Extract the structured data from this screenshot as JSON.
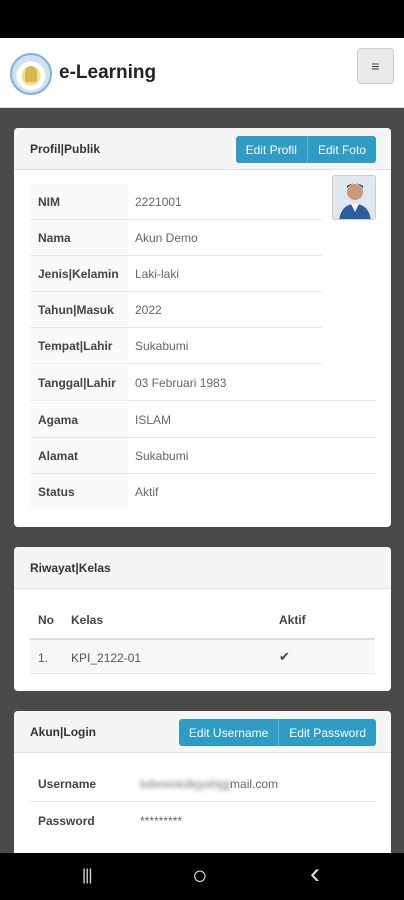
{
  "app": {
    "brand": "e-Learning",
    "menu_icon": "≡"
  },
  "profile": {
    "title": "Profil|Publik",
    "edit_profile": "Edit Profil",
    "edit_photo": "Edit Foto",
    "fields": [
      {
        "label": "NIM",
        "value": "2221001"
      },
      {
        "label": "Nama",
        "value": "Akun Demo"
      },
      {
        "label": "Jenis|Kelamin",
        "value": "Laki-laki"
      },
      {
        "label": "Tahun|Masuk",
        "value": "2022"
      },
      {
        "label": "Tempat|Lahir",
        "value": "Sukabumi"
      },
      {
        "label": "Tanggal|Lahir",
        "value": "03 Februari 1983"
      },
      {
        "label": "Agama",
        "value": "ISLAM"
      },
      {
        "label": "Alamat",
        "value": "Sukabumi"
      },
      {
        "label": "Status",
        "value": "Aktif"
      }
    ]
  },
  "history": {
    "title": "Riwayat|Kelas",
    "headers": {
      "no": "No",
      "kelas": "Kelas",
      "aktif": "Aktif"
    },
    "rows": [
      {
        "no": "1.",
        "kelas": "KPI_2122-01",
        "aktif": "✔"
      }
    ]
  },
  "account": {
    "title": "Akun|Login",
    "edit_username": "Edit Username",
    "edit_password": "Edit Password",
    "username_label": "Username",
    "username_blurred": "kdiewokdkjyahjgj",
    "username_suffix": "mail.com",
    "password_label": "Password",
    "password_value": "*********"
  },
  "system_nav": {
    "recents": "|||",
    "home": "○",
    "back": "‹"
  }
}
